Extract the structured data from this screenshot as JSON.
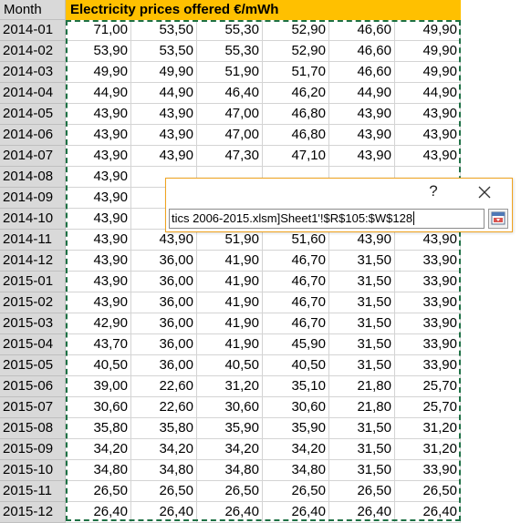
{
  "header": {
    "month_label": "Month",
    "title": "Electricity prices offered €/mWh"
  },
  "rows": [
    {
      "month": "2014-01",
      "values": [
        "71,00",
        "53,50",
        "55,30",
        "52,90",
        "46,60",
        "49,90"
      ]
    },
    {
      "month": "2014-02",
      "values": [
        "53,90",
        "53,50",
        "55,30",
        "52,90",
        "46,60",
        "49,90"
      ]
    },
    {
      "month": "2014-03",
      "values": [
        "49,90",
        "49,90",
        "51,90",
        "51,70",
        "46,60",
        "49,90"
      ]
    },
    {
      "month": "2014-04",
      "values": [
        "44,90",
        "44,90",
        "46,40",
        "46,20",
        "44,90",
        "44,90"
      ]
    },
    {
      "month": "2014-05",
      "values": [
        "43,90",
        "43,90",
        "47,00",
        "46,80",
        "43,90",
        "43,90"
      ]
    },
    {
      "month": "2014-06",
      "values": [
        "43,90",
        "43,90",
        "47,00",
        "46,80",
        "43,90",
        "43,90"
      ]
    },
    {
      "month": "2014-07",
      "values": [
        "43,90",
        "43,90",
        "47,30",
        "47,10",
        "43,90",
        "43,90"
      ]
    },
    {
      "month": "2014-08",
      "values": [
        "43,90",
        "",
        "",
        "",
        "",
        ""
      ]
    },
    {
      "month": "2014-09",
      "values": [
        "43,90",
        "",
        "",
        "",
        "",
        ""
      ]
    },
    {
      "month": "2014-10",
      "values": [
        "43,90",
        "",
        "",
        "",
        "",
        ""
      ]
    },
    {
      "month": "2014-11",
      "values": [
        "43,90",
        "43,90",
        "51,90",
        "51,60",
        "43,90",
        "43,90"
      ]
    },
    {
      "month": "2014-12",
      "values": [
        "43,90",
        "36,00",
        "41,90",
        "46,70",
        "31,50",
        "33,90"
      ]
    },
    {
      "month": "2015-01",
      "values": [
        "43,90",
        "36,00",
        "41,90",
        "46,70",
        "31,50",
        "33,90"
      ]
    },
    {
      "month": "2015-02",
      "values": [
        "43,90",
        "36,00",
        "41,90",
        "46,70",
        "31,50",
        "33,90"
      ]
    },
    {
      "month": "2015-03",
      "values": [
        "42,90",
        "36,00",
        "41,90",
        "46,70",
        "31,50",
        "33,90"
      ]
    },
    {
      "month": "2015-04",
      "values": [
        "43,70",
        "36,00",
        "41,90",
        "45,90",
        "31,50",
        "33,90"
      ]
    },
    {
      "month": "2015-05",
      "values": [
        "40,50",
        "36,00",
        "40,50",
        "40,50",
        "31,50",
        "33,90"
      ]
    },
    {
      "month": "2015-06",
      "values": [
        "39,00",
        "22,60",
        "31,20",
        "35,10",
        "21,80",
        "25,70"
      ]
    },
    {
      "month": "2015-07",
      "values": [
        "30,60",
        "22,60",
        "30,60",
        "30,60",
        "21,80",
        "25,70"
      ]
    },
    {
      "month": "2015-08",
      "values": [
        "35,80",
        "35,80",
        "35,90",
        "35,90",
        "31,50",
        "31,20"
      ]
    },
    {
      "month": "2015-09",
      "values": [
        "34,20",
        "34,20",
        "34,20",
        "34,20",
        "31,50",
        "31,20"
      ]
    },
    {
      "month": "2015-10",
      "values": [
        "34,80",
        "34,80",
        "34,80",
        "34,80",
        "31,50",
        "33,90"
      ]
    },
    {
      "month": "2015-11",
      "values": [
        "26,50",
        "26,50",
        "26,50",
        "26,50",
        "26,50",
        "26,50"
      ]
    },
    {
      "month": "2015-12",
      "values": [
        "26,40",
        "26,40",
        "26,40",
        "26,40",
        "26,40",
        "26,40"
      ]
    }
  ],
  "dialog": {
    "help_label": "?",
    "range_value": "tics 2006-2015.xlsm]Sheet1'!$R$105:$W$128",
    "close_icon": "close-icon",
    "collapse_icon": "expand-dialog-icon"
  },
  "colors": {
    "title_fill": "#ffc000",
    "row_header_fill": "#d9d9d9",
    "selection_border": "#1e7145",
    "dialog_border": "#f0a31f"
  }
}
